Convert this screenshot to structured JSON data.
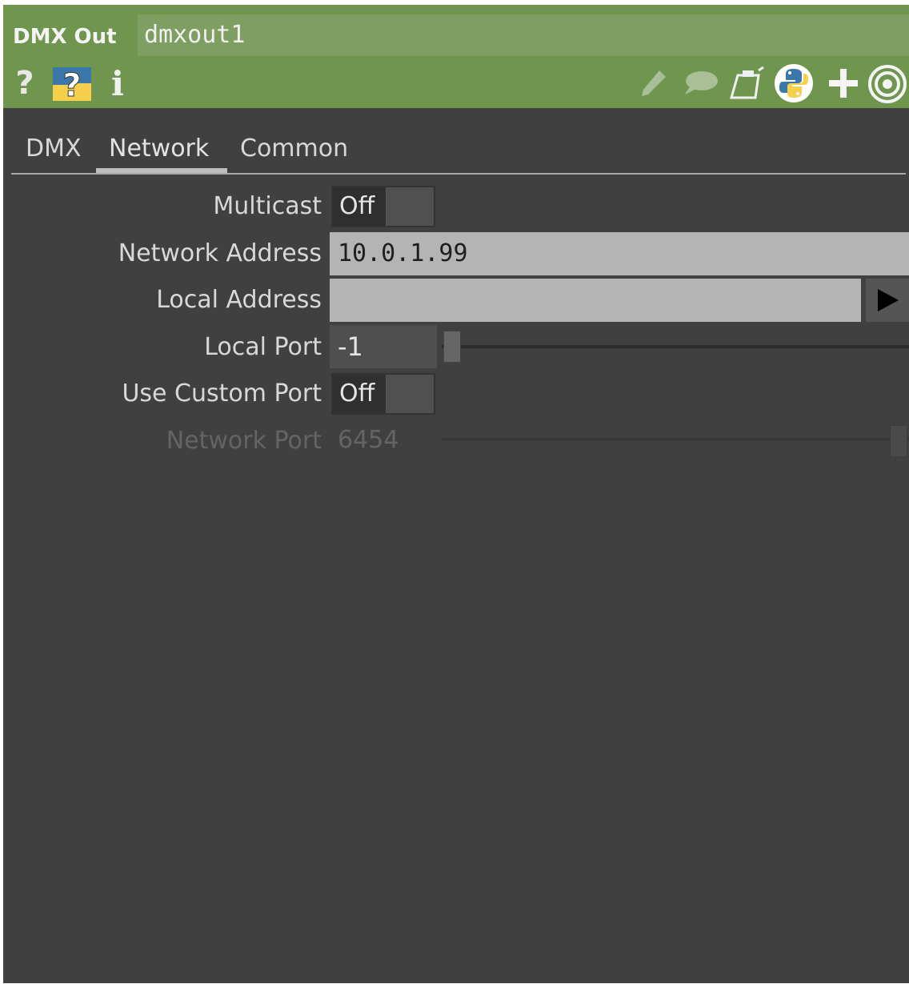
{
  "header": {
    "op_type": "DMX Out",
    "op_name": "dmxout1",
    "icons": [
      "help-icon",
      "python-help-icon",
      "info-icon",
      "edit-icon",
      "comment-icon",
      "clipboard-icon",
      "python-icon",
      "add-icon",
      "target-icon"
    ]
  },
  "tabs": [
    {
      "label": "DMX",
      "active": false
    },
    {
      "label": "Network",
      "active": true
    },
    {
      "label": "Common",
      "active": false
    }
  ],
  "params": {
    "multicast": {
      "label": "Multicast",
      "value": "Off"
    },
    "network_address": {
      "label": "Network Address",
      "value": "10.0.1.99"
    },
    "local_address": {
      "label": "Local Address",
      "value": ""
    },
    "local_port": {
      "label": "Local Port",
      "value": "-1"
    },
    "use_custom_port": {
      "label": "Use Custom Port",
      "value": "Off"
    },
    "network_port": {
      "label": "Network Port",
      "value": "6454",
      "enabled": false
    }
  },
  "colors": {
    "header_bg": "#6f954f",
    "panel_bg": "#404040",
    "field_bg": "#b4b4b4",
    "python_blue": "#3b77a8",
    "python_yellow": "#f6cf4c"
  }
}
